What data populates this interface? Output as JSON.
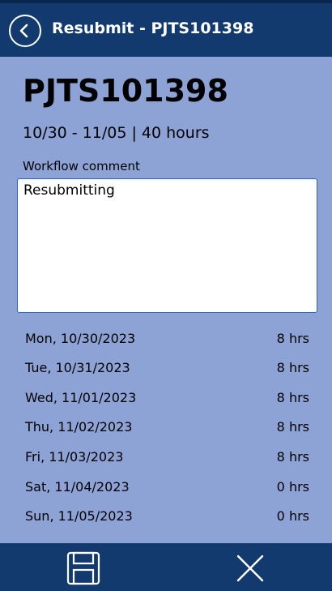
{
  "header": {
    "title": "Resubmit - PJTS101398",
    "back_icon": "back-arrow-circle-icon"
  },
  "timesheet": {
    "id": "PJTS101398",
    "summary": "10/30 - 11/05 | 40 hours"
  },
  "comment": {
    "label": "Workflow comment",
    "value": "Resubmitting"
  },
  "days": [
    {
      "date": "Mon, 10/30/2023",
      "hours": "8 hrs"
    },
    {
      "date": "Tue, 10/31/2023",
      "hours": "8 hrs"
    },
    {
      "date": "Wed, 11/01/2023",
      "hours": "8 hrs"
    },
    {
      "date": "Thu, 11/02/2023",
      "hours": "8 hrs"
    },
    {
      "date": "Fri, 11/03/2023",
      "hours": "8 hrs"
    },
    {
      "date": "Sat, 11/04/2023",
      "hours": "0 hrs"
    },
    {
      "date": "Sun, 11/05/2023",
      "hours": "0 hrs"
    }
  ],
  "footer": {
    "save_icon": "save-floppy-icon",
    "close_icon": "close-x-icon"
  },
  "colors": {
    "header_bg": "#123a6f",
    "page_bg": "#8da3d6",
    "input_border": "#2e63c4"
  }
}
